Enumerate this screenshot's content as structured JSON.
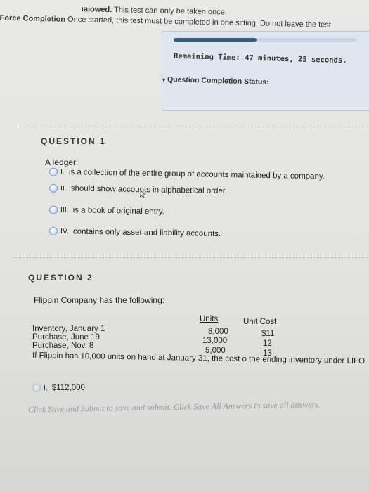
{
  "header": {
    "top_fragment_bold": "ıaıowed.",
    "top_fragment_text": " This test can only be taken once.",
    "force_label": "Force Completion",
    "force_text": " Once started, this test must be completed in one sitting. Do not leave the test"
  },
  "timer": {
    "remaining": "Remaining Time: 47 minutes, 25 seconds.",
    "status_label": "Question Completion Status:"
  },
  "q1": {
    "title": "QUESTION 1",
    "prompt": "A ledger:",
    "options": [
      {
        "num": "I.",
        "text": "is a collection of the entire group of accounts maintained by a company."
      },
      {
        "num": "II.",
        "text": "should show accounts in alphabetical order."
      },
      {
        "num": "III.",
        "text": "is a book of original entry."
      },
      {
        "num": "IV.",
        "text": "contains only asset and liability accounts."
      }
    ]
  },
  "q2": {
    "title": "QUESTION 2",
    "prompt": "Flippin Company has the following:",
    "col_units": "Units",
    "col_cost": "Unit Cost",
    "rows": [
      {
        "label": "Inventory, January 1",
        "units": "8,000",
        "cost": "$11"
      },
      {
        "label": "Purchase, June 19",
        "units": "13,000",
        "cost": "12"
      },
      {
        "label": "Purchase, Nov. 8",
        "units": "5,000",
        "cost": "13"
      }
    ],
    "question": "If Flippin has 10,000 units on hand at January 31, the cost o the ending inventory under LIFO",
    "option_num": "I.",
    "option_text": "$112,000"
  },
  "footer": {
    "save_text": "Click Save and Submit to save and submit. Click Save All Answers to save all answers."
  }
}
